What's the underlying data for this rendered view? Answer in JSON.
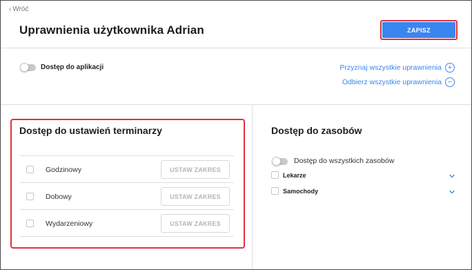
{
  "header": {
    "back_label": "Wróć",
    "title": "Uprawnienia użytkownika Adrian",
    "save_label": "ZAPISZ"
  },
  "app_access": {
    "label": "Dostęp do aplikacji",
    "enabled": false
  },
  "links": {
    "grant_all": "Przyznaj wszystkie uprawnienia",
    "revoke_all": "Odbierz wszystkie uprawnienia"
  },
  "schedules": {
    "title": "Dostęp do ustawień terminarzy",
    "rows": [
      {
        "label": "Godzinowy",
        "checked": false,
        "button": "USTAW ZAKRES"
      },
      {
        "label": "Dobowy",
        "checked": false,
        "button": "USTAW ZAKRES"
      },
      {
        "label": "Wydarzeniowy",
        "checked": false,
        "button": "USTAW ZAKRES"
      }
    ]
  },
  "resources": {
    "title": "Dostęp do zasobów",
    "all_label": "Dostęp do wszystkich zasobów",
    "all_enabled": false,
    "items": [
      {
        "label": "Lekarze",
        "checked": false
      },
      {
        "label": "Samochody",
        "checked": false
      }
    ]
  },
  "icons": {
    "back": "chevron-left-icon",
    "grant": "plus-circle-icon",
    "revoke": "minus-circle-icon",
    "expand": "chevron-down-icon"
  },
  "colors": {
    "accent": "#3a86f0",
    "highlight": "#e0313b",
    "disabled_text": "#b5b5b5"
  }
}
